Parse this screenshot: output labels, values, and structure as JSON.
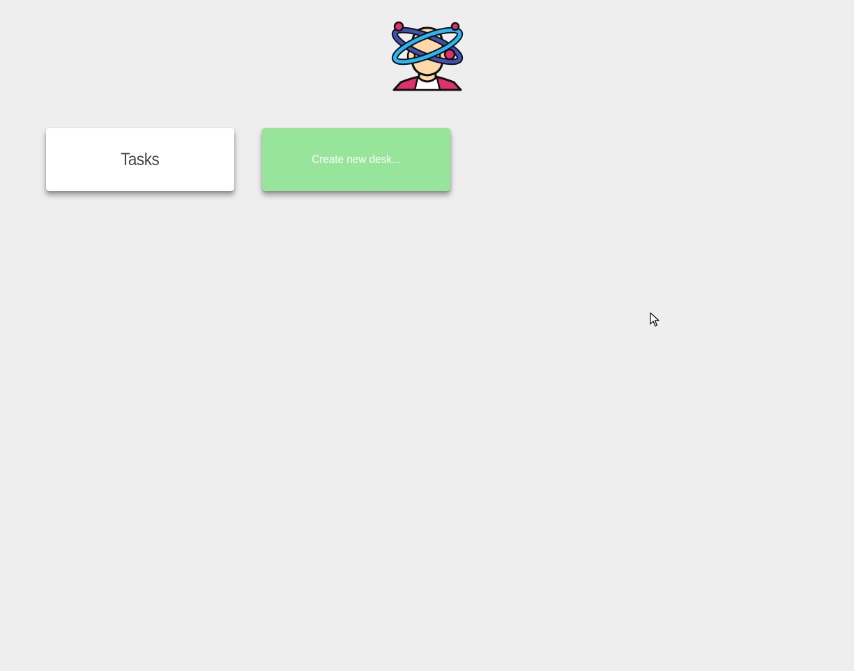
{
  "header": {
    "logo_icon": "atom-head-icon"
  },
  "desks": {
    "items": [
      {
        "label": "Tasks"
      }
    ],
    "create_label": "Create new desk..."
  },
  "colors": {
    "background": "#eeeeee",
    "card": "#ffffff",
    "create_card": "#97e59b",
    "card_text": "#444444",
    "create_text": "#ffffff"
  },
  "pointer": {
    "icon": "mouse-pointer-icon"
  }
}
